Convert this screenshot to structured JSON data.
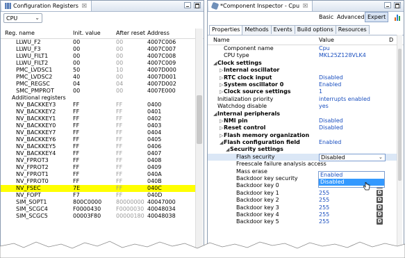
{
  "left": {
    "tab_title": "Configuration Registers",
    "tab_close": "☒",
    "cpu_select": "CPU",
    "columns": [
      "Reg. name",
      "Init. value",
      "After reset",
      "Address"
    ],
    "rows": [
      {
        "name": "LLWU_F2",
        "init": "00",
        "reset": "00",
        "addr": "4007C006"
      },
      {
        "name": "LLWU_F3",
        "init": "00",
        "reset": "00",
        "addr": "4007C007"
      },
      {
        "name": "LLWU_FILT1",
        "init": "00",
        "reset": "00",
        "addr": "4007C008"
      },
      {
        "name": "LLWU_FILT2",
        "init": "00",
        "reset": "00",
        "addr": "4007C009"
      },
      {
        "name": "PMC_LVDSC1",
        "init": "50",
        "reset": "10",
        "addr": "4007D000"
      },
      {
        "name": "PMC_LVDSC2",
        "init": "40",
        "reset": "00",
        "addr": "4007D001"
      },
      {
        "name": "PMC_REGSC",
        "init": "04",
        "reset": "04",
        "addr": "4007D002"
      },
      {
        "name": "SMC_PMPROT",
        "init": "00",
        "reset": "00",
        "addr": "4007E000"
      },
      {
        "name": "Additional registers",
        "init": "",
        "reset": "",
        "addr": "",
        "section": true
      },
      {
        "name": "NV_BACKKEY3",
        "init": "FF",
        "reset": "FF",
        "addr": "0400"
      },
      {
        "name": "NV_BACKKEY2",
        "init": "FF",
        "reset": "FF",
        "addr": "0401"
      },
      {
        "name": "NV_BACKKEY1",
        "init": "FF",
        "reset": "FF",
        "addr": "0402"
      },
      {
        "name": "NV_BACKKEY0",
        "init": "FF",
        "reset": "FF",
        "addr": "0403"
      },
      {
        "name": "NV_BACKKEY7",
        "init": "FF",
        "reset": "FF",
        "addr": "0404"
      },
      {
        "name": "NV_BACKKEY6",
        "init": "FF",
        "reset": "FF",
        "addr": "0405"
      },
      {
        "name": "NV_BACKKEY5",
        "init": "FF",
        "reset": "FF",
        "addr": "0406"
      },
      {
        "name": "NV_BACKKEY4",
        "init": "FF",
        "reset": "FF",
        "addr": "0407"
      },
      {
        "name": "NV_FPROT3",
        "init": "FF",
        "reset": "FF",
        "addr": "0408"
      },
      {
        "name": "NV_FPROT2",
        "init": "FF",
        "reset": "FF",
        "addr": "0409"
      },
      {
        "name": "NV_FPROT1",
        "init": "FF",
        "reset": "FF",
        "addr": "040A"
      },
      {
        "name": "NV_FPROT0",
        "init": "FF",
        "reset": "FF",
        "addr": "040B"
      },
      {
        "name": "NV_FSEC",
        "init": "7E",
        "reset": "FF",
        "addr": "040C",
        "highlight": true
      },
      {
        "name": "NV_FOPT",
        "init": "F7",
        "reset": "FF",
        "addr": "040D"
      },
      {
        "name": "SIM_SOPT1",
        "init": "800C0000",
        "reset": "80000000",
        "addr": "40047000"
      },
      {
        "name": "SIM_SCGC4",
        "init": "F0000430",
        "reset": "F0000030",
        "addr": "40048034"
      },
      {
        "name": "SIM_SCGC5",
        "init": "00003F80",
        "reset": "00000180",
        "addr": "40048038"
      }
    ],
    "highlight_color": "#ffff00"
  },
  "right": {
    "tab_title": "*Component Inspector - Cpu",
    "tab_close": "☒",
    "toolbar": [
      "Basic",
      "Advanced",
      "Expert"
    ],
    "toolbar_active": "Expert",
    "subtabs": [
      "Properties",
      "Methods",
      "Events",
      "Build options",
      "Resources"
    ],
    "columns": [
      "Name",
      "Value",
      "D"
    ],
    "rows": [
      {
        "indent": 1,
        "arrow": "",
        "name": "Component name",
        "value": "Cpu",
        "blue": true
      },
      {
        "indent": 1,
        "arrow": "",
        "name": "CPU type",
        "value": "MKL25Z128VLK4",
        "blue": true
      },
      {
        "indent": 0,
        "arrow": "◢",
        "name": "Clock settings",
        "value": "",
        "bold": true
      },
      {
        "indent": 1,
        "arrow": "▷",
        "name": "Internal oscillator",
        "value": "",
        "bold": true
      },
      {
        "indent": 1,
        "arrow": "▷",
        "name": "RTC clock input",
        "value": "Disabled",
        "bold": true,
        "blue": true
      },
      {
        "indent": 1,
        "arrow": "▷",
        "name": "System oscillator 0",
        "value": "Enabled",
        "bold": true,
        "blue": true
      },
      {
        "indent": 1,
        "arrow": "▷",
        "name": "Clock source settings",
        "value": "1",
        "bold": true,
        "blue": true
      },
      {
        "indent": 0,
        "arrow": "",
        "name": "Initialization priority",
        "value": "interrupts enabled",
        "blue": true
      },
      {
        "indent": 0,
        "arrow": "",
        "name": "Watchdog disable",
        "value": "yes",
        "blue": true
      },
      {
        "indent": 0,
        "arrow": "◢",
        "name": "Internal peripherals",
        "value": "",
        "bold": true
      },
      {
        "indent": 1,
        "arrow": "▷",
        "name": "NMI pin",
        "value": "Disabled",
        "bold": true,
        "blue": true
      },
      {
        "indent": 1,
        "arrow": "▷",
        "name": "Reset control",
        "value": "Disabled",
        "bold": true,
        "blue": true
      },
      {
        "indent": 1,
        "arrow": "▷",
        "name": "Flash memory organization",
        "value": "",
        "bold": true
      },
      {
        "indent": 1,
        "arrow": "◢",
        "name": "Flash configuration field",
        "value": "Enabled",
        "bold": true,
        "blue": true
      },
      {
        "indent": 2,
        "arrow": "◢",
        "name": "Security settings",
        "value": "",
        "bold": true
      },
      {
        "indent": 3,
        "arrow": "",
        "name": "Flash security",
        "value": "Disabled",
        "selected": true
      },
      {
        "indent": 3,
        "arrow": "",
        "name": "Freescale failure analysis access",
        "value": ""
      },
      {
        "indent": 3,
        "arrow": "",
        "name": "Mass erase",
        "value": ""
      },
      {
        "indent": 3,
        "arrow": "",
        "name": "Backdoor key security",
        "value": "Disabled",
        "blue": true
      },
      {
        "indent": 3,
        "arrow": "",
        "name": "Backdoor key 0",
        "value": "255",
        "blue": true,
        "dbtn": "D"
      },
      {
        "indent": 3,
        "arrow": "",
        "name": "Backdoor key 1",
        "value": "255",
        "blue": true,
        "dbtn": "D"
      },
      {
        "indent": 3,
        "arrow": "",
        "name": "Backdoor key 2",
        "value": "255",
        "blue": true,
        "dbtn": "D"
      },
      {
        "indent": 3,
        "arrow": "",
        "name": "Backdoor key 3",
        "value": "255",
        "blue": true,
        "dbtn": "D"
      },
      {
        "indent": 3,
        "arrow": "",
        "name": "Backdoor key 4",
        "value": "255",
        "blue": true,
        "dbtn": "D"
      },
      {
        "indent": 3,
        "arrow": "",
        "name": "Backdoor key 5",
        "value": "255",
        "blue": true,
        "dbtn": "D"
      }
    ],
    "dropdown_options": [
      "Enabled",
      "Disabled"
    ],
    "dropdown_hover": "Disabled",
    "side_glyphs": [
      "1",
      "N"
    ],
    "value_color": "#1a4fbf"
  }
}
